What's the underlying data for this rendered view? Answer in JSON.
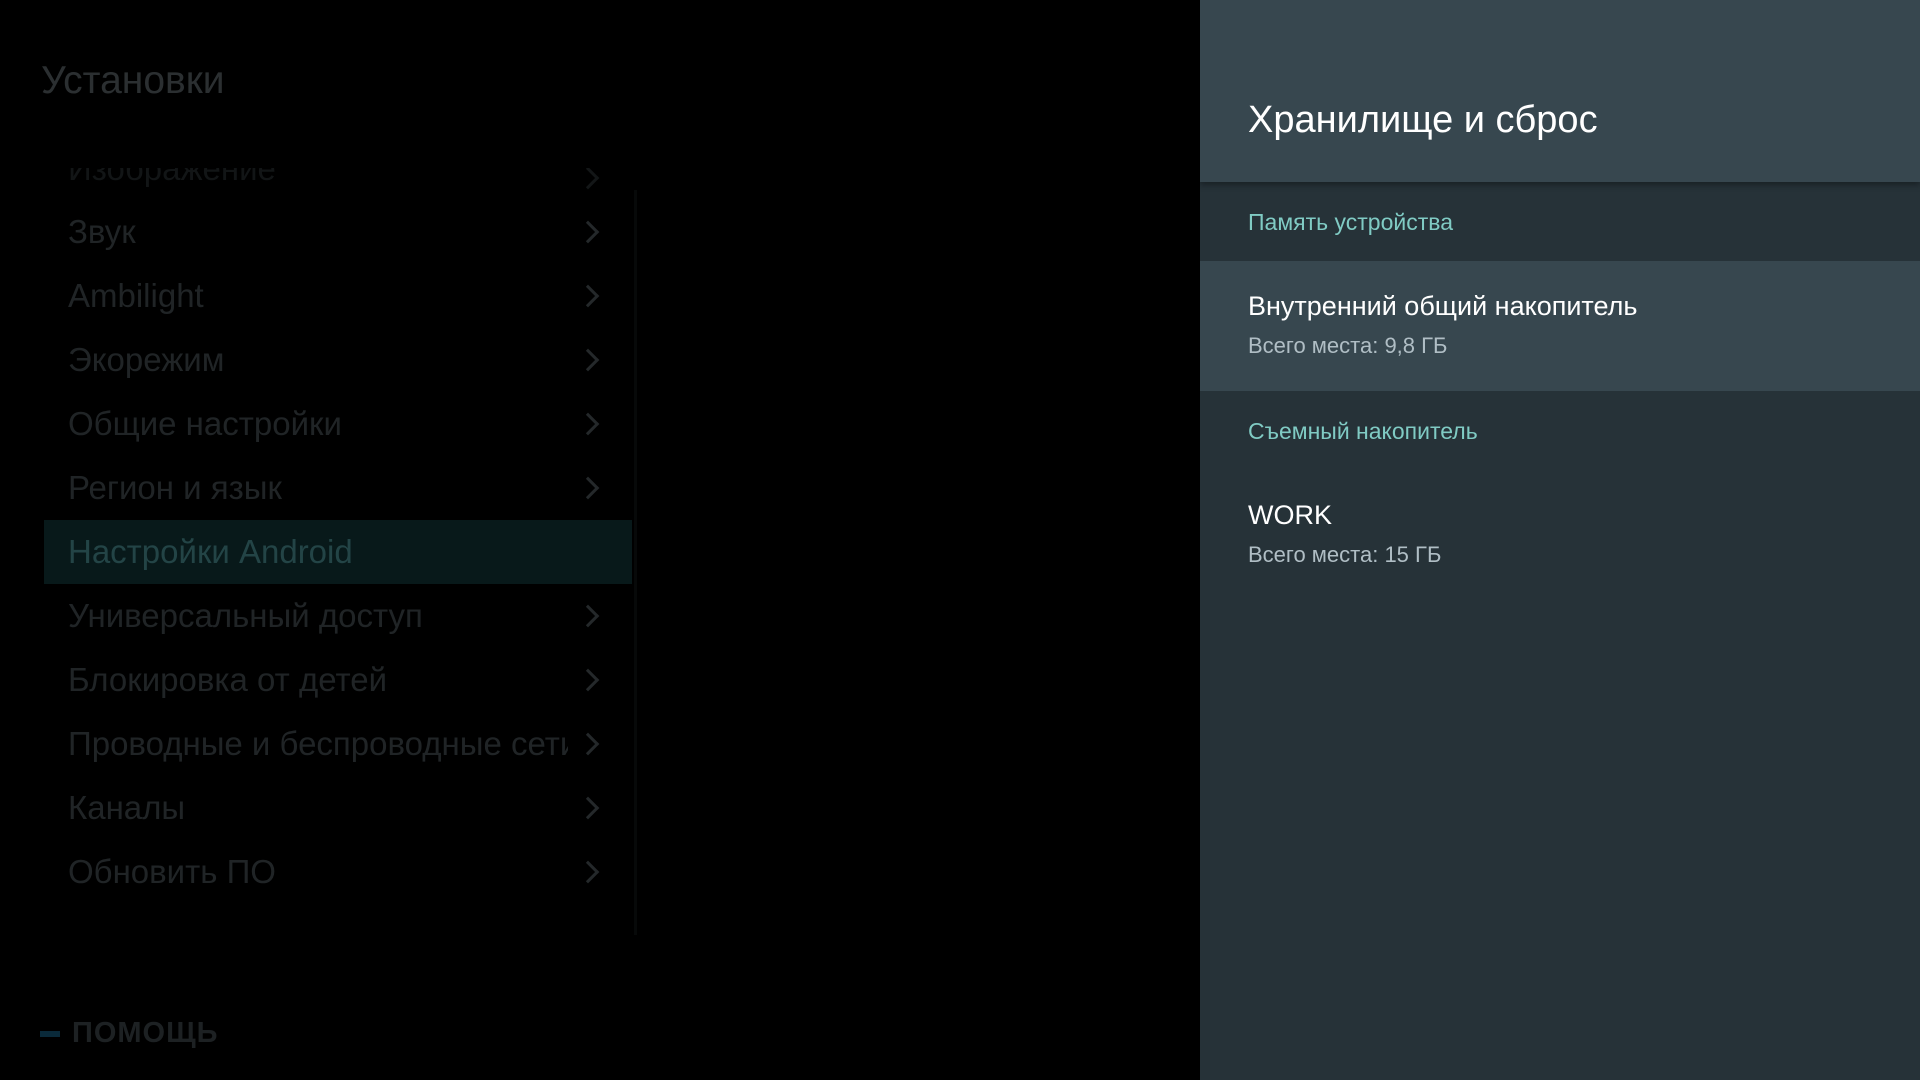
{
  "menu": {
    "title": "Установки",
    "items": [
      {
        "label": "Изображение",
        "has_chevron": true
      },
      {
        "label": "Звук",
        "has_chevron": true
      },
      {
        "label": "Ambilight",
        "has_chevron": true
      },
      {
        "label": "Экорежим",
        "has_chevron": true
      },
      {
        "label": "Общие настройки",
        "has_chevron": true
      },
      {
        "label": "Регион и язык",
        "has_chevron": true
      },
      {
        "label": "Настройки Android",
        "has_chevron": false
      },
      {
        "label": "Универсальный доступ",
        "has_chevron": true
      },
      {
        "label": "Блокировка от детей",
        "has_chevron": true
      },
      {
        "label": "Проводные и беспроводные сети",
        "has_chevron": true
      },
      {
        "label": "Каналы",
        "has_chevron": true
      },
      {
        "label": "Обновить ПО",
        "has_chevron": true
      }
    ],
    "selected_index": 6,
    "help_label": "ПОМОЩЬ"
  },
  "panel": {
    "title": "Хранилище и сброс",
    "sections": [
      {
        "label": "Память устройства",
        "items": [
          {
            "name": "Внутренний общий накопитель",
            "size": "Всего места: 9,8 ГБ"
          }
        ]
      },
      {
        "label": "Съемный накопитель",
        "items": [
          {
            "name": "WORK",
            "size": "Всего места: 15 ГБ"
          }
        ]
      }
    ]
  },
  "colors": {
    "panel_background": "#263238",
    "panel_header": "#37474f",
    "section_accent": "#80cbc4",
    "selected_menu_background": "#08191a"
  }
}
